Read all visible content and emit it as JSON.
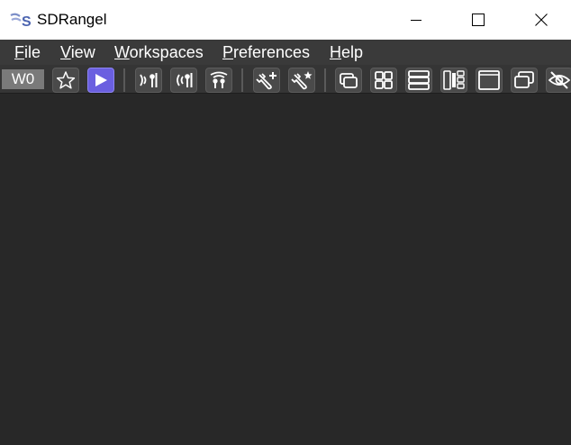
{
  "window": {
    "title": "SDRangel"
  },
  "menubar": {
    "items": [
      {
        "accel": "F",
        "rest": "ile"
      },
      {
        "accel": "V",
        "rest": "iew"
      },
      {
        "accel": "W",
        "rest": "orkspaces"
      },
      {
        "accel": "P",
        "rest": "references"
      },
      {
        "accel": "H",
        "rest": "elp"
      }
    ]
  },
  "toolbar": {
    "workspace_label": "W0",
    "icons": [
      "favorite-star-icon",
      "play-icon",
      "add-rx-device-icon",
      "add-tx-device-icon",
      "add-mimo-device-icon",
      "add-feature-icon",
      "feature-presets-icon",
      "cascade-windows-icon",
      "tile-windows-icon",
      "stack-windows-icon",
      "stack-subwindows-icon",
      "maximize-window-icon",
      "restore-window-icon",
      "hide-icon"
    ]
  },
  "colors": {
    "titlebar_bg": "#ffffff",
    "menubar_bg": "#3a3a3a",
    "toolbar_bg": "#353535",
    "workspace_bg": "#282828",
    "active_button": "#6a5fe0"
  }
}
